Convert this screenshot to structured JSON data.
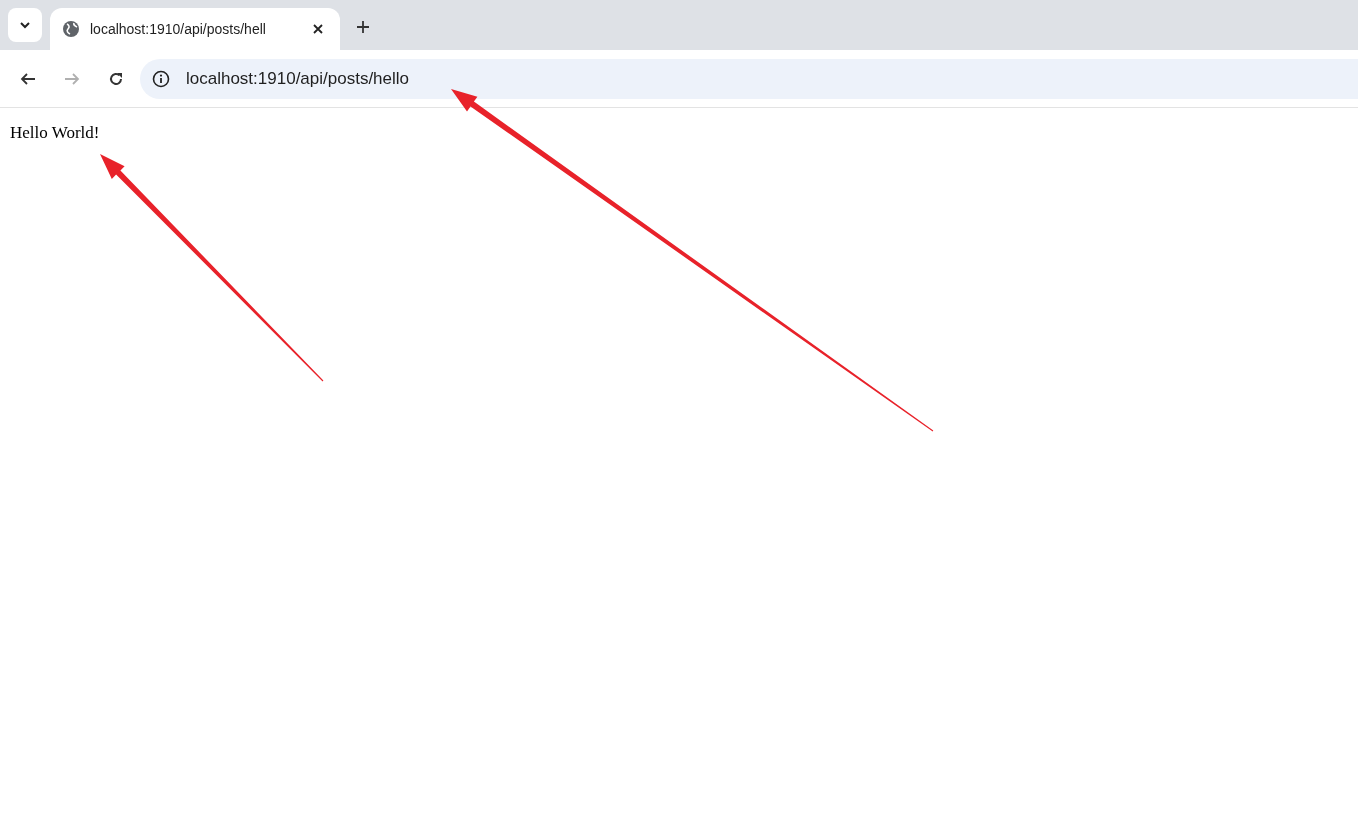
{
  "browser": {
    "tabs": [
      {
        "title": "localhost:1910/api/posts/hell",
        "selected": true
      }
    ],
    "nav": {
      "back_disabled": false,
      "forward_disabled": true
    },
    "address": "localhost:1910/api/posts/hello"
  },
  "page": {
    "text": "Hello World!"
  }
}
